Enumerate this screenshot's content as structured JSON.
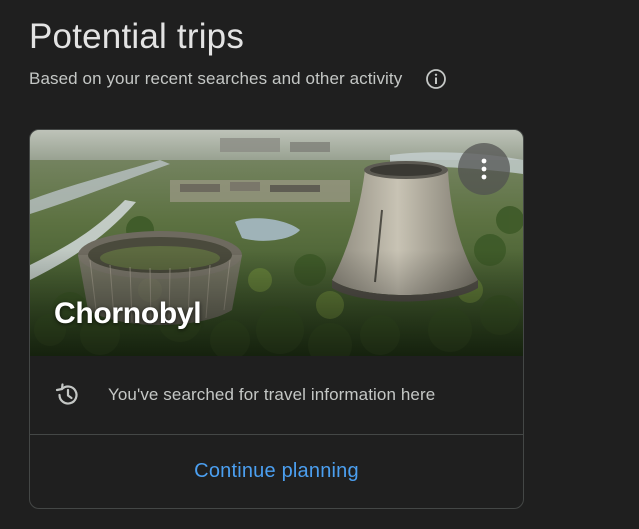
{
  "header": {
    "title": "Potential trips",
    "subtitle": "Based on your recent searches and other activity",
    "info_icon": "info-icon"
  },
  "trip_card": {
    "destination": "Chornobyl",
    "more_icon": "more-vert-icon",
    "history_icon": "history-icon",
    "reason_text": "You've searched for travel information here",
    "action_label": "Continue planning"
  },
  "colors": {
    "background": "#1f1f1f",
    "text_primary": "#e3e3e3",
    "text_secondary": "#c4c7c5",
    "divider": "#444746",
    "accent": "#4b9ff0"
  }
}
